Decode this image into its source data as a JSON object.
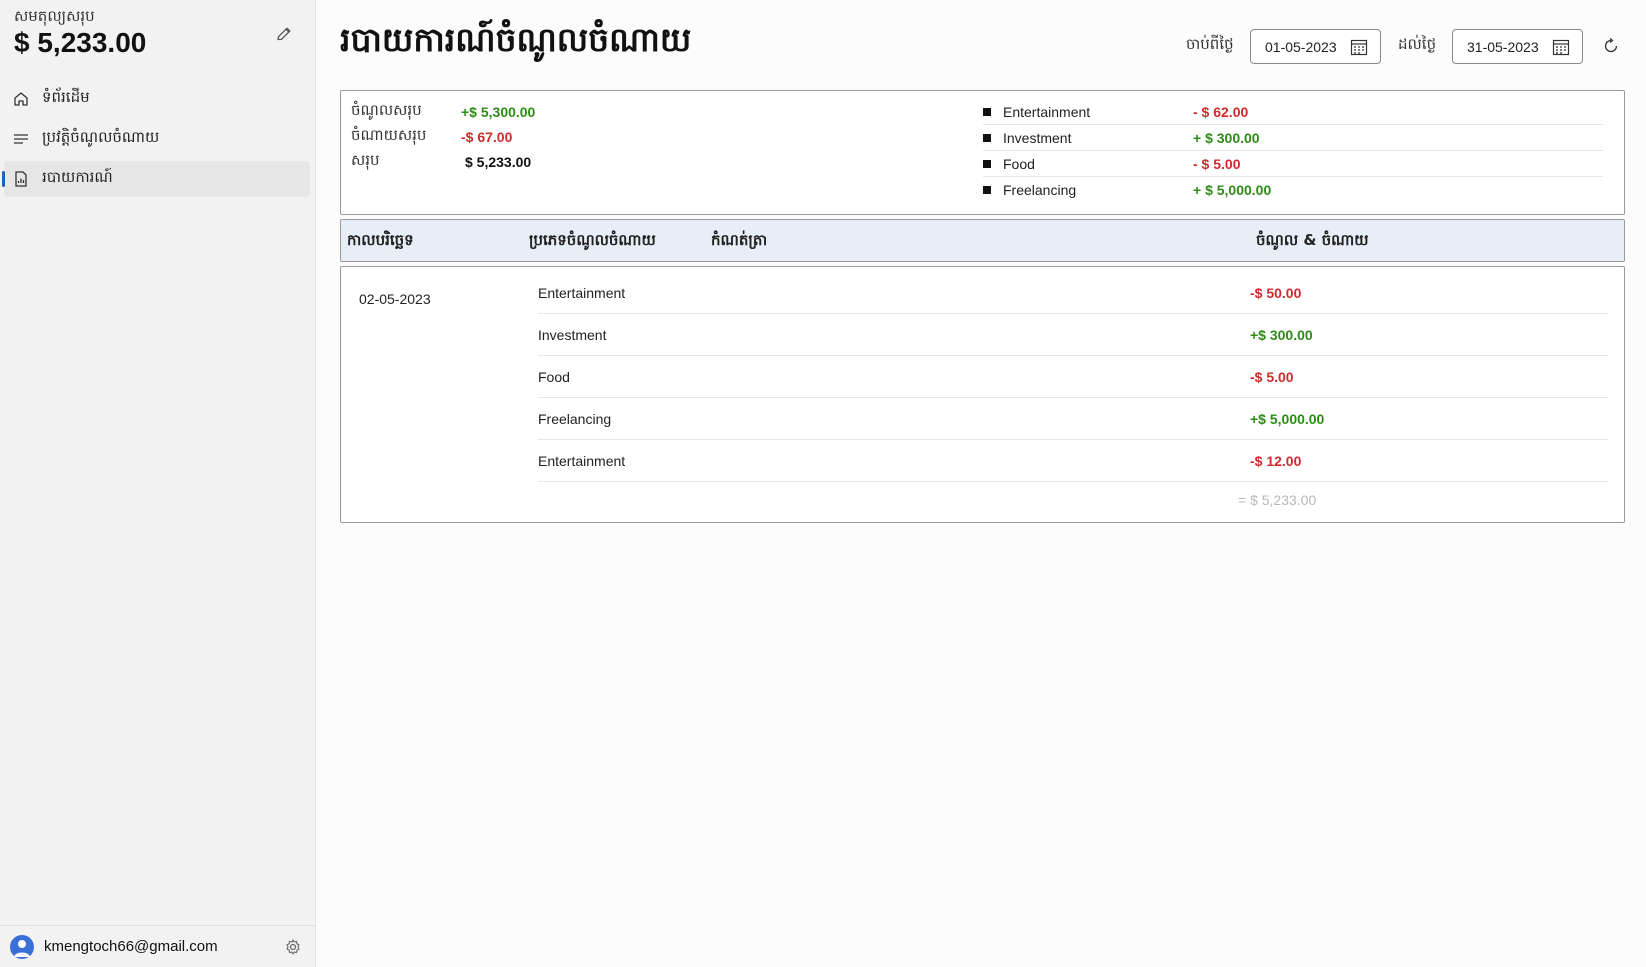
{
  "sidebar": {
    "balance_label": "សមតុល្យសរុប",
    "balance_value": "$ 5,233.00",
    "nav": [
      {
        "label": "ទំព័រដើម",
        "icon": "home-icon"
      },
      {
        "label": "ប្រវត្តិចំណូលចំណាយ",
        "icon": "list-icon"
      },
      {
        "label": "របាយការណ៍",
        "icon": "report-icon"
      }
    ],
    "user_email": "kmengtoch66@gmail.com"
  },
  "header": {
    "title": "របាយការណ៍ចំណូលចំណាយ",
    "from_label": "ចាប់ពីថ្ងៃ",
    "from_date": "01-05-2023",
    "to_label": "ដល់ថ្ងៃ",
    "to_date": "31-05-2023"
  },
  "summary": {
    "income_label": "ចំណូលសរុប",
    "income_value": "+$ 5,300.00",
    "expense_label": "ចំណាយសរុប",
    "expense_value": "-$ 67.00",
    "total_label": "សរុប",
    "total_value": "$ 5,233.00",
    "categories": [
      {
        "name": "Entertainment",
        "amount": "- $ 62.00"
      },
      {
        "name": "Investment",
        "amount": "+ $ 300.00"
      },
      {
        "name": "Food",
        "amount": "- $ 5.00"
      },
      {
        "name": "Freelancing",
        "amount": "+ $ 5,000.00"
      }
    ]
  },
  "table": {
    "headers": [
      "កាលបរិច្ឆេទ",
      "ប្រភេទចំណូលចំណាយ",
      "កំណត់ត្រា",
      "ចំណូល & ចំណាយ"
    ],
    "groups": [
      {
        "date": "02-05-2023",
        "rows": [
          {
            "category": "Entertainment",
            "amount": "-$ 50.00"
          },
          {
            "category": "Investment",
            "amount": "+$ 300.00"
          },
          {
            "category": "Food",
            "amount": "-$ 5.00"
          },
          {
            "category": "Freelancing",
            "amount": "+$ 5,000.00"
          },
          {
            "category": "Entertainment",
            "amount": "-$ 12.00"
          }
        ],
        "total": "=  $ 5,233.00"
      }
    ]
  },
  "colors": {
    "income": "#2e8b17",
    "expense": "#d02b2b",
    "accent": "#1f5fbf",
    "header_bg": "#e7eef8"
  }
}
